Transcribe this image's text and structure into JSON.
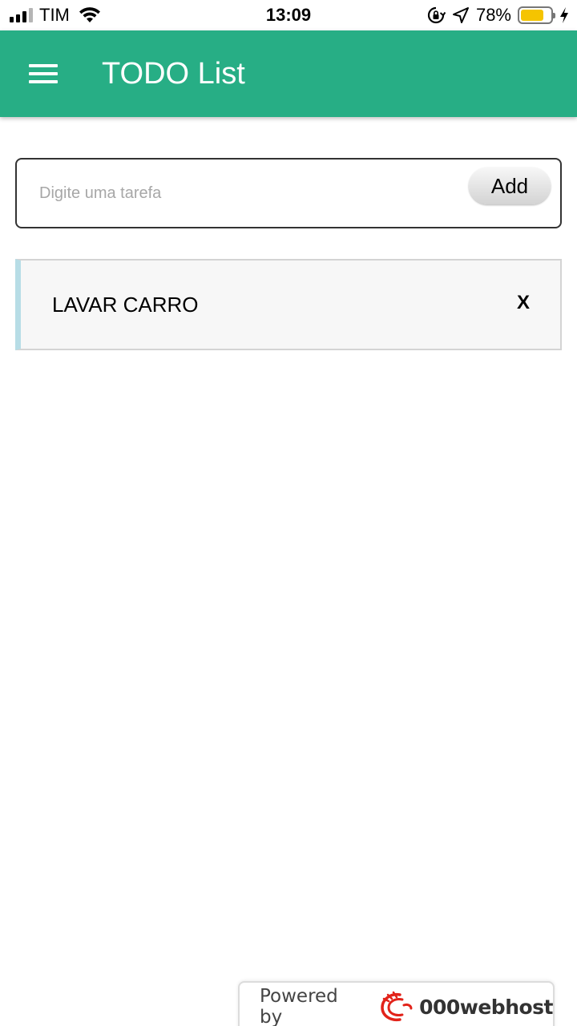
{
  "status_bar": {
    "carrier": "TIM",
    "time": "13:09",
    "battery_percent": "78%",
    "battery_level": 0.78,
    "battery_color": "#f5c400",
    "icons": [
      "signal-icon",
      "wifi-icon",
      "rotation-lock-icon",
      "location-icon",
      "battery-icon",
      "charging-bolt-icon"
    ]
  },
  "toolbar": {
    "title": "TODO List",
    "menu_icon": "hamburger-menu-icon",
    "background_color": "#27ae85"
  },
  "add_form": {
    "input_value": "",
    "input_placeholder": "Digite uma tarefa",
    "add_label": "Add"
  },
  "tasks": [
    {
      "text": "LAVAR CARRO",
      "delete_label": "X"
    }
  ],
  "footer": {
    "powered_label": "Powered by",
    "brand": "000webhost",
    "logo_icon": "000webhost-logo-icon"
  }
}
